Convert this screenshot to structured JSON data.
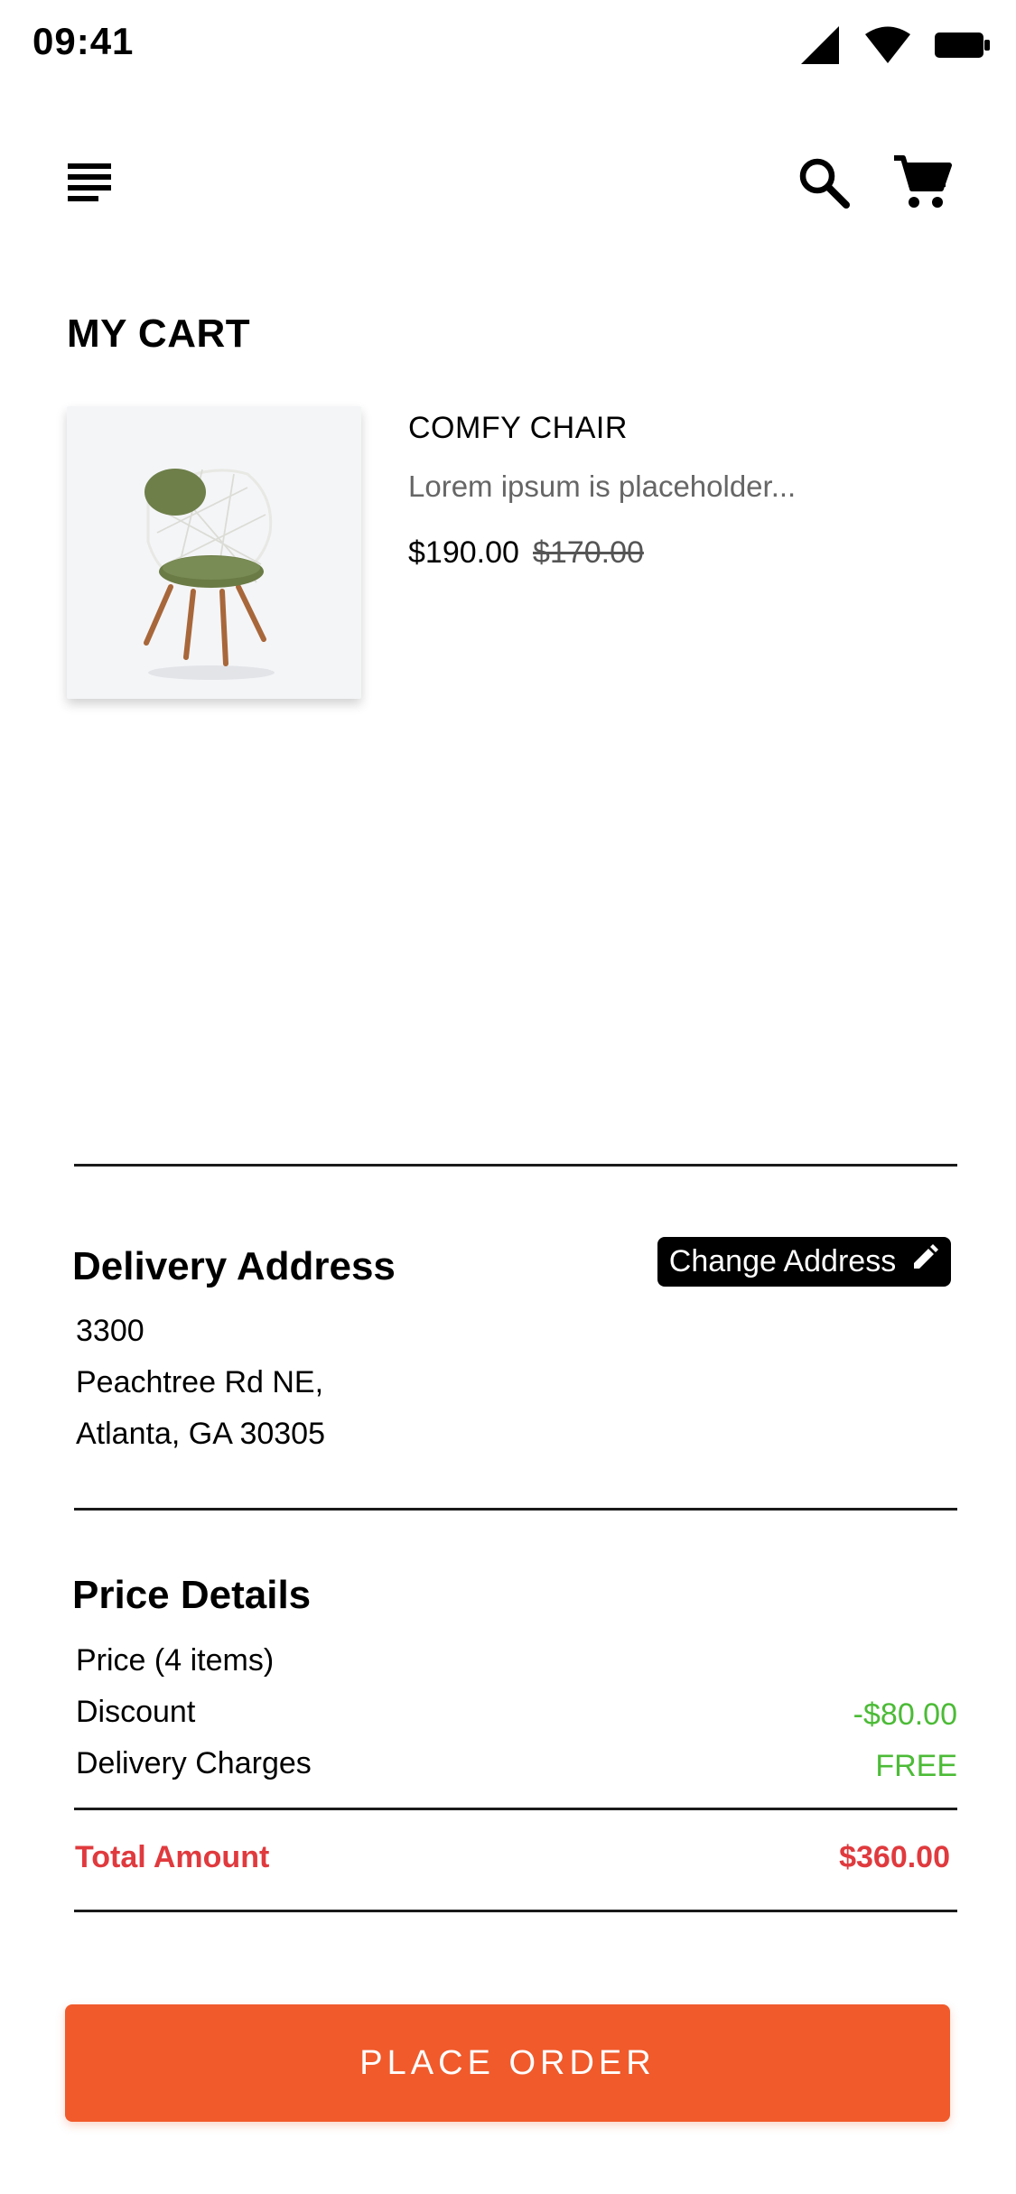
{
  "status_bar": {
    "time": "09:41"
  },
  "header": {
    "menu_icon": "menu-icon",
    "search_icon": "search-icon",
    "cart_icon": "cart-icon"
  },
  "page": {
    "title": "MY CART"
  },
  "cart_items": [
    {
      "name": "COMFY CHAIR",
      "description": "Lorem ipsum is placeholder...",
      "price": "$190.00",
      "original_price": "$170.00"
    }
  ],
  "delivery": {
    "title": "Delivery Address",
    "change_label": "Change Address",
    "address_lines": [
      "3300",
      "Peachtree Rd NE,",
      "Atlanta, GA 30305"
    ]
  },
  "price_details": {
    "title": "Price Details",
    "price_label": "Price (4 items)",
    "discount_label": "Discount",
    "discount_value": "-$80.00",
    "delivery_label": "Delivery Charges",
    "delivery_value": "FREE",
    "total_label": "Total Amount",
    "total_value": "$360.00"
  },
  "actions": {
    "place_order": "PLACE ORDER"
  },
  "colors": {
    "accent": "#f15a2b",
    "total": "#e03a3e",
    "positive": "#4cbb37"
  }
}
